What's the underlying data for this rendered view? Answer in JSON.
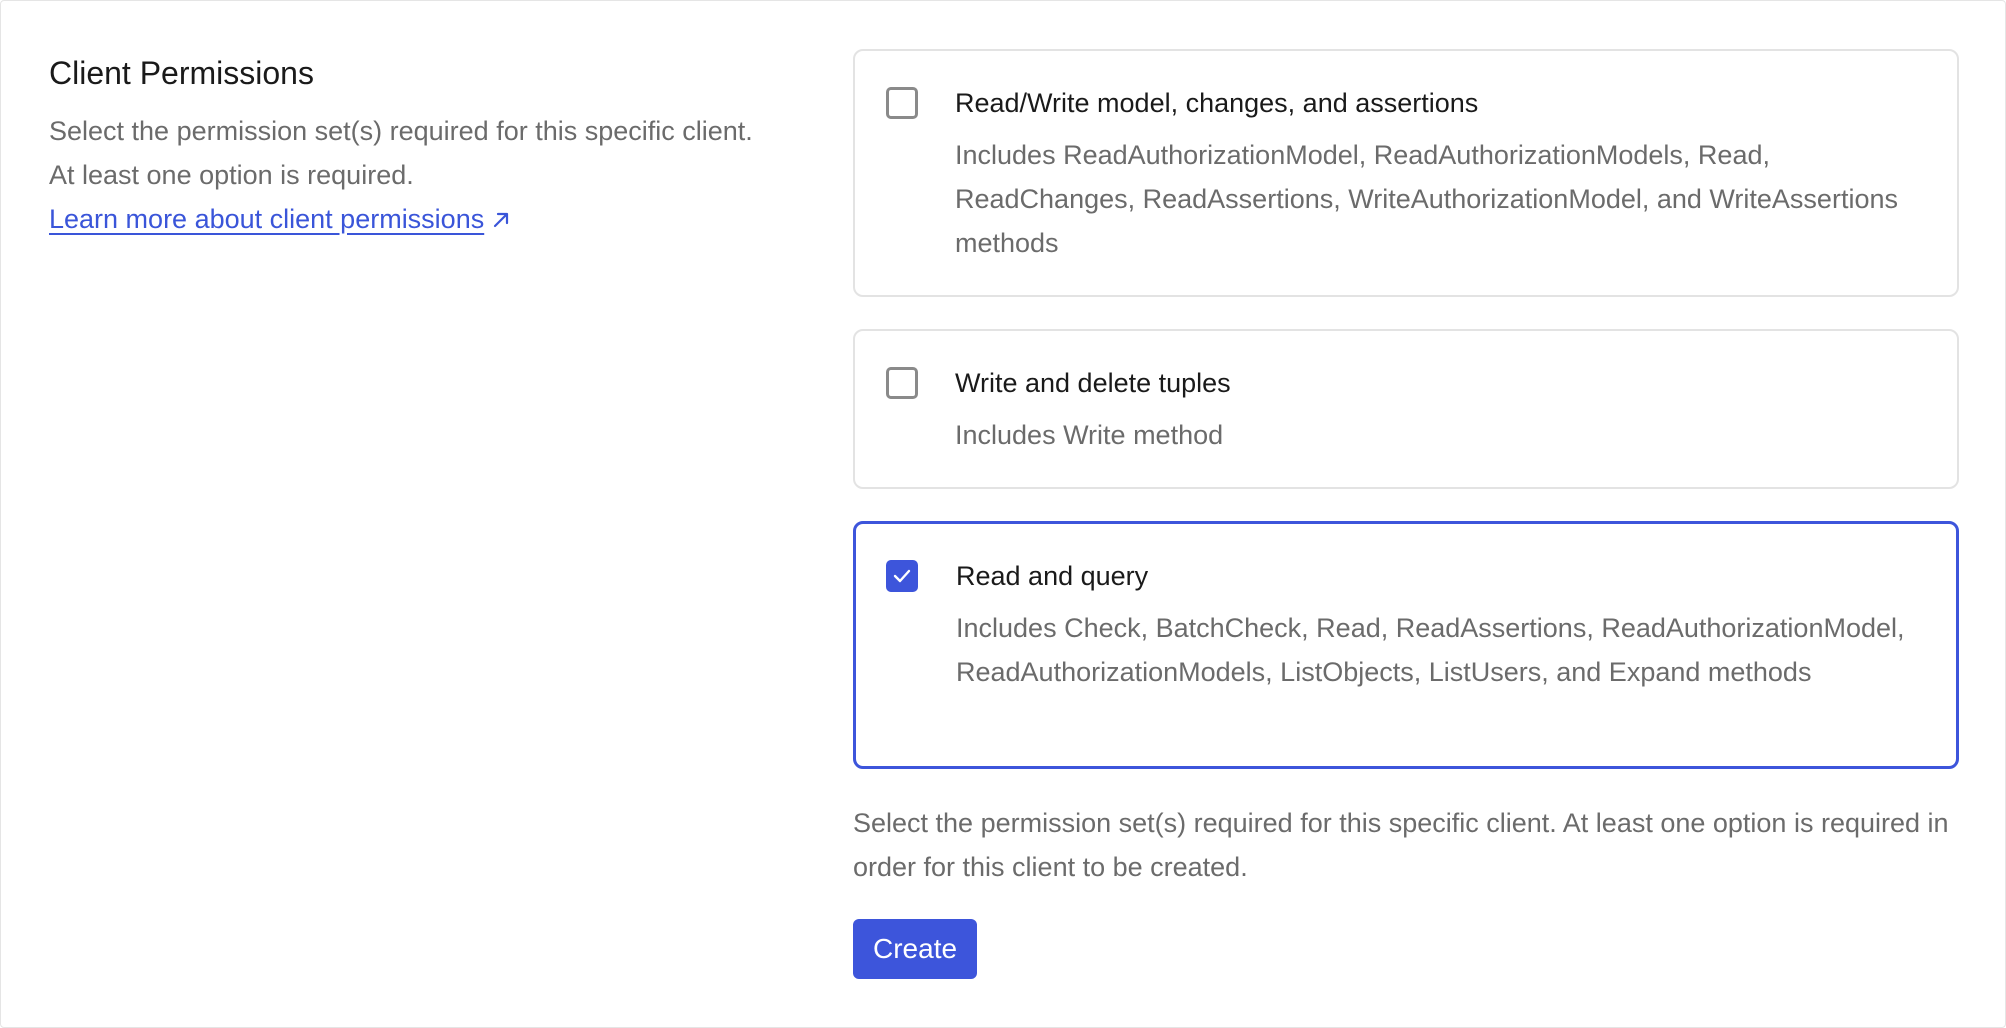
{
  "header": {
    "title": "Client Permissions",
    "description": "Select the permission set(s) required for this specific client. At least one option is required.",
    "learn_more_label": "Learn more about client permissions"
  },
  "options": [
    {
      "title": "Read/Write model, changes, and assertions",
      "description": "Includes ReadAuthorizationModel, ReadAuthorizationModels, Read, ReadChanges, ReadAssertions, WriteAuthorizationModel, and WriteAssertions methods",
      "checked": false
    },
    {
      "title": "Write and delete tuples",
      "description": "Includes Write method",
      "checked": false
    },
    {
      "title": "Read and query",
      "description": "Includes Check, BatchCheck, Read, ReadAssertions, ReadAuthorizationModel, ReadAuthorizationModels, ListObjects, ListUsers, and Expand methods",
      "checked": true
    }
  ],
  "footer": {
    "note": "Select the permission set(s) required for this specific client. At least one option is required in order for this client to be created.",
    "create_label": "Create"
  },
  "icons": {
    "external_link": "external-link-icon",
    "check": "check-icon"
  },
  "colors": {
    "accent": "#3d55db",
    "link": "#3a55d9",
    "muted_text": "#6b6b6b",
    "border": "#e3e3e3"
  }
}
